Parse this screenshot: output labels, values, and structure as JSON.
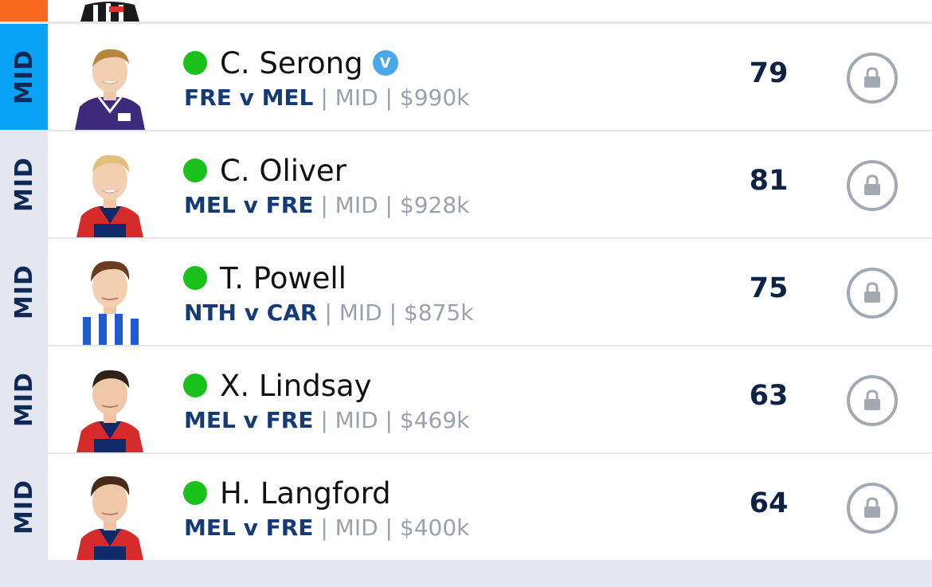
{
  "colors": {
    "active_tab": "#0aa3f5",
    "prev_tab": "#f7691e",
    "inactive_tab": "#e4e7ef",
    "status_dot": "#19c11a",
    "fixture_text": "#143a78",
    "muted_text": "#9aa1ad",
    "vc_badge": "#4aa8e8"
  },
  "players": [
    {
      "position_tab": "MID",
      "active": true,
      "name": "C. Serong",
      "badge": "V",
      "fixture": "FRE v MEL",
      "position": "MID",
      "price": "$990k",
      "score": "79",
      "status": "available",
      "icon": "lock-icon"
    },
    {
      "position_tab": "MID",
      "active": false,
      "name": "C. Oliver",
      "badge": "",
      "fixture": "MEL v FRE",
      "position": "MID",
      "price": "$928k",
      "score": "81",
      "status": "available",
      "icon": "lock-icon"
    },
    {
      "position_tab": "MID",
      "active": false,
      "name": "T. Powell",
      "badge": "",
      "fixture": "NTH v CAR",
      "position": "MID",
      "price": "$875k",
      "score": "75",
      "status": "available",
      "icon": "lock-icon"
    },
    {
      "position_tab": "MID",
      "active": false,
      "name": "X. Lindsay",
      "badge": "",
      "fixture": "MEL v FRE",
      "position": "MID",
      "price": "$469k",
      "score": "63",
      "status": "available",
      "icon": "lock-icon"
    },
    {
      "position_tab": "MID",
      "active": false,
      "name": "H. Langford",
      "badge": "",
      "fixture": "MEL v FRE",
      "position": "MID",
      "price": "$400k",
      "score": "64",
      "status": "available",
      "icon": "lock-icon"
    }
  ],
  "separator": "|"
}
